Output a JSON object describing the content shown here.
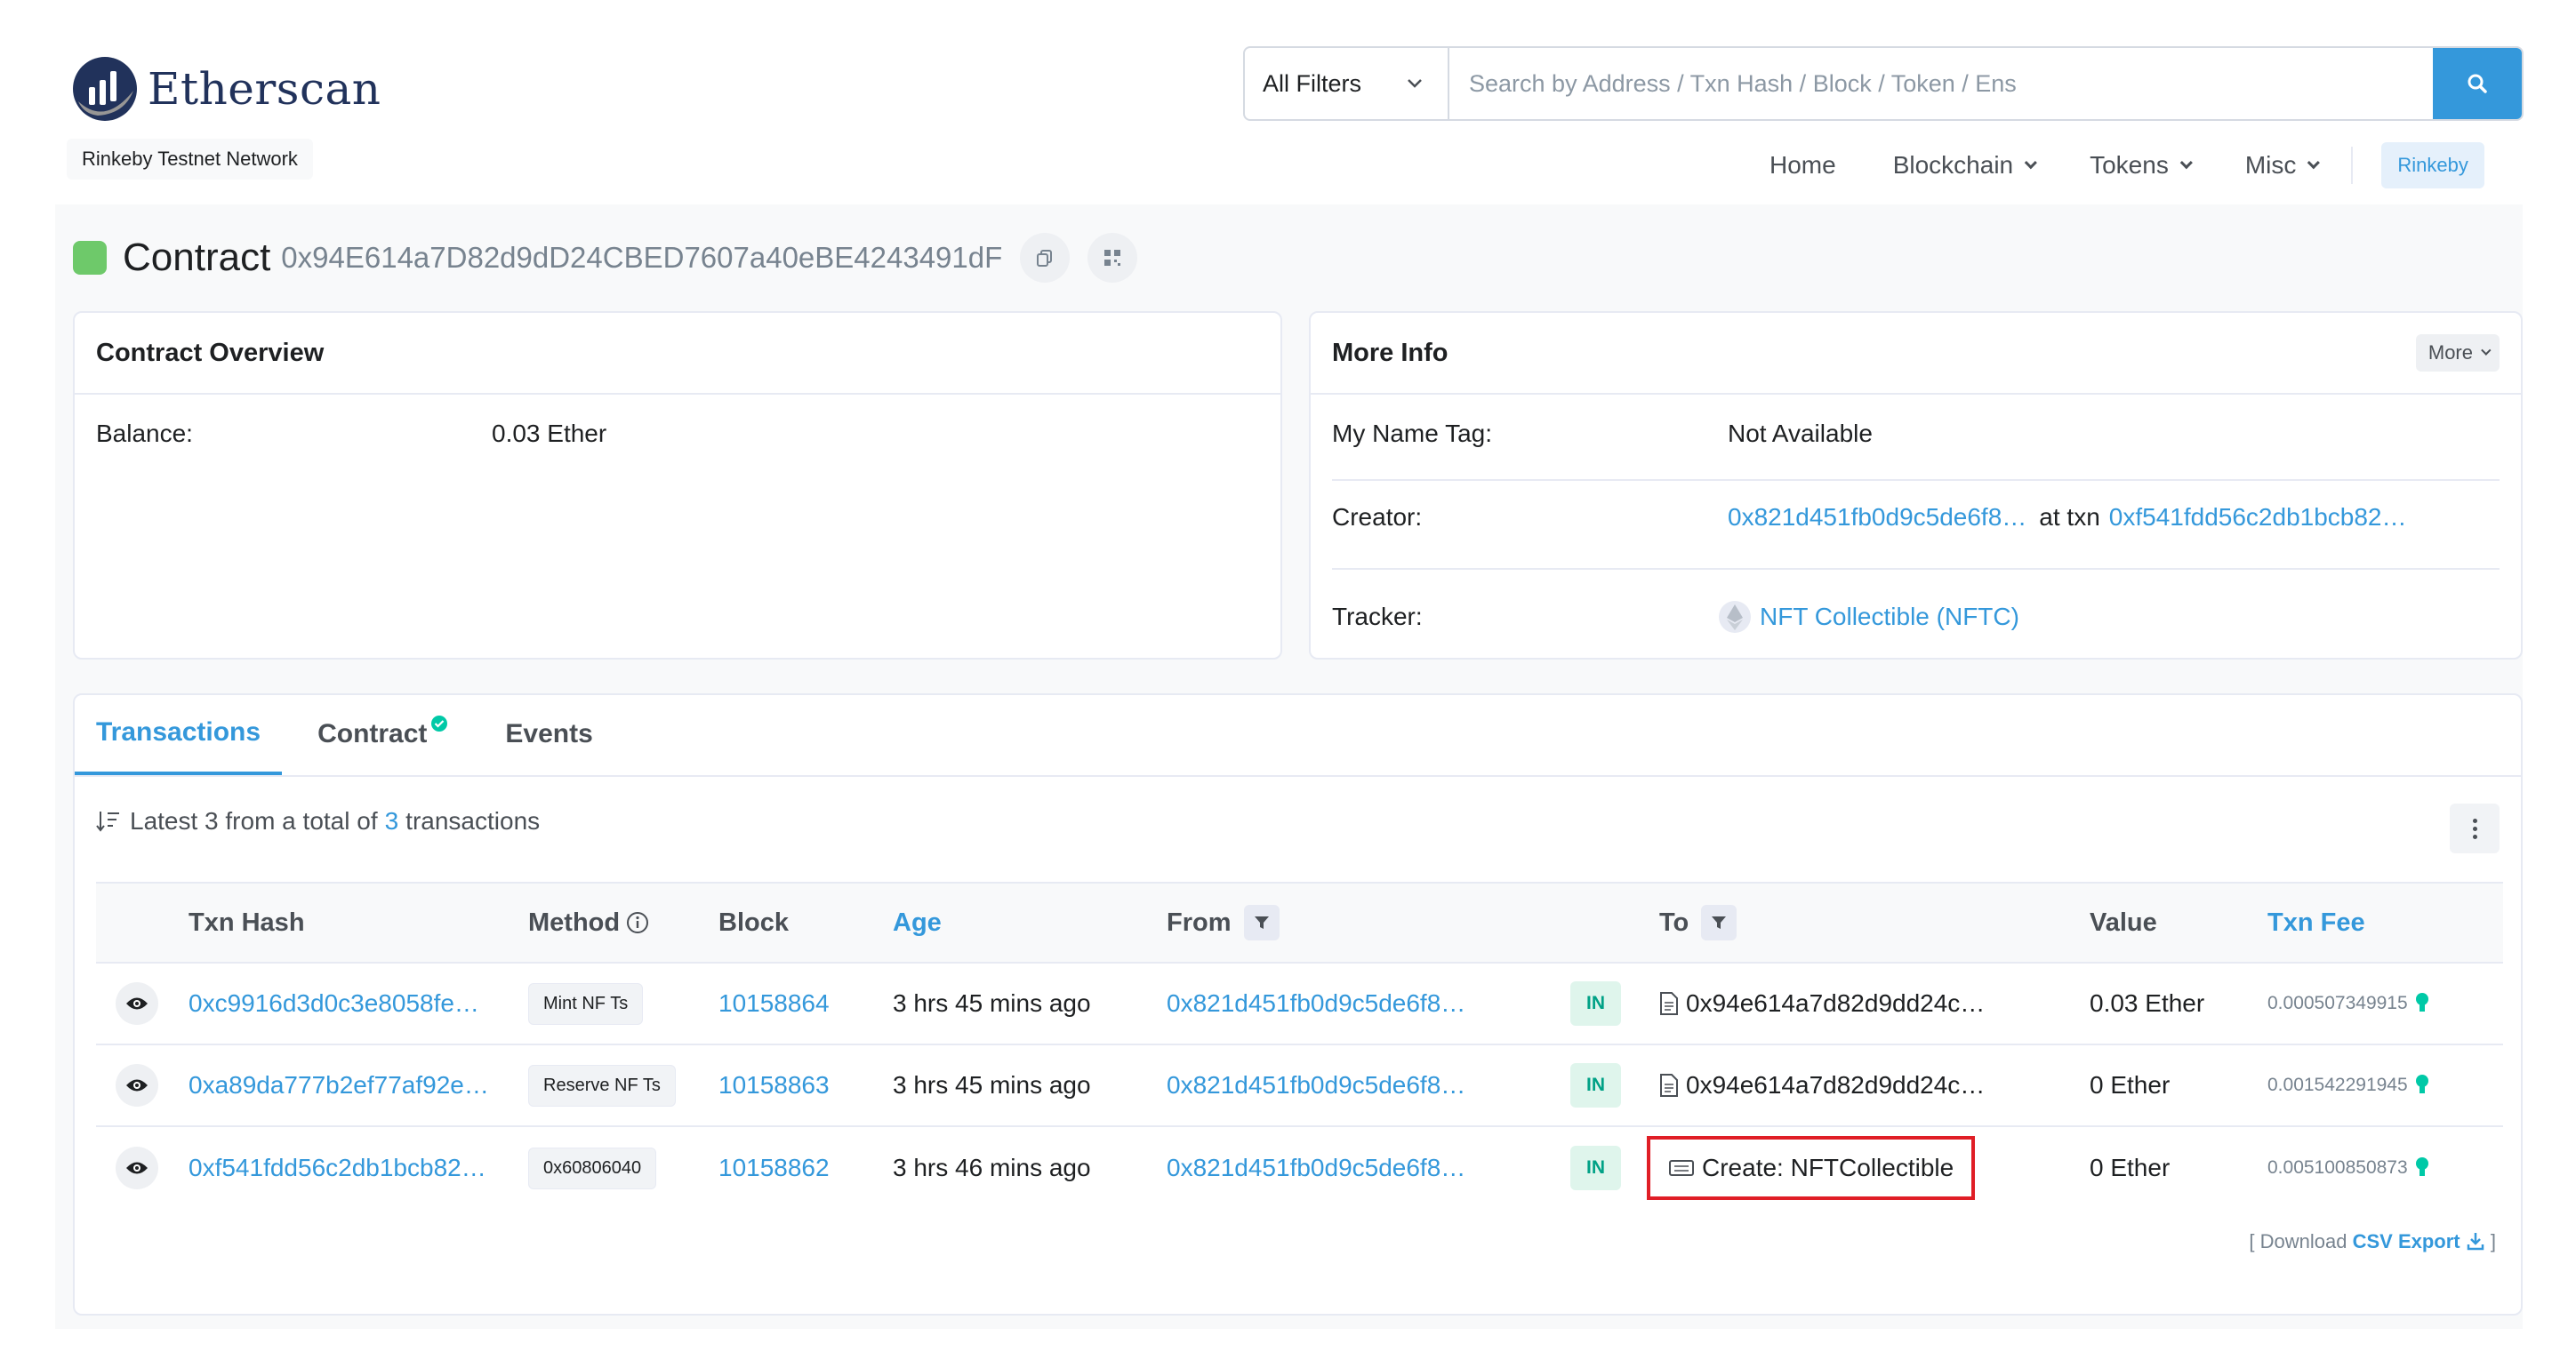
{
  "header": {
    "logo_text": "Etherscan",
    "network_badge": "Rinkeby Testnet Network",
    "search": {
      "filter_label": "All Filters",
      "placeholder": "Search by Address / Txn Hash / Block / Token / Ens"
    },
    "nav": {
      "home": "Home",
      "blockchain": "Blockchain",
      "tokens": "Tokens",
      "misc": "Misc",
      "network_button": "Rinkeby"
    }
  },
  "contract": {
    "title": "Contract",
    "address": "0x94E614a7D82d9dD24CBED7607a40eBE4243491dF"
  },
  "overview": {
    "heading": "Contract Overview",
    "balance_label": "Balance:",
    "balance_value": "0.03 Ether"
  },
  "more_info": {
    "heading": "More Info",
    "more_button": "More",
    "name_tag_label": "My Name Tag:",
    "name_tag_value": "Not Available",
    "creator_label": "Creator:",
    "creator_address": "0x821d451fb0d9c5de6f8…",
    "creator_at_txn": "at txn",
    "creator_txn": "0xf541fdd56c2db1bcb82…",
    "tracker_label": "Tracker:",
    "tracker_value": "NFT Collectible (NFTC)"
  },
  "tabs": {
    "transactions": "Transactions",
    "contract": "Contract",
    "events": "Events"
  },
  "summary": {
    "prefix": "Latest 3 from a total of",
    "count": "3",
    "suffix": "transactions"
  },
  "table": {
    "headers": {
      "txn_hash": "Txn Hash",
      "method": "Method",
      "block": "Block",
      "age": "Age",
      "from": "From",
      "to": "To",
      "value": "Value",
      "txn_fee": "Txn Fee"
    },
    "rows": [
      {
        "hash": "0xc9916d3d0c3e8058fe…",
        "method": "Mint NF Ts",
        "block": "10158864",
        "age": "3 hrs 45 mins ago",
        "from": "0x821d451fb0d9c5de6f8…",
        "direction": "IN",
        "to": "0x94e614a7d82d9dd24c…",
        "value": "0.03 Ether",
        "fee": "0.000507349915"
      },
      {
        "hash": "0xa89da777b2ef77af92e…",
        "method": "Reserve NF Ts",
        "block": "10158863",
        "age": "3 hrs 45 mins ago",
        "from": "0x821d451fb0d9c5de6f8…",
        "direction": "IN",
        "to": "0x94e614a7d82d9dd24c…",
        "value": "0 Ether",
        "fee": "0.001542291945"
      },
      {
        "hash": "0xf541fdd56c2db1bcb82…",
        "method": "0x60806040",
        "block": "10158862",
        "age": "3 hrs 46 mins ago",
        "from": "0x821d451fb0d9c5de6f8…",
        "direction": "IN",
        "to": "Create: NFTCollectible",
        "value": "0 Ether",
        "fee": "0.005100850873"
      }
    ]
  },
  "csv": {
    "prefix": "[ Download",
    "label": "CSV Export",
    "suffix": "]"
  },
  "colors": {
    "accent": "#3498db",
    "highlight": "#e01e26",
    "in_badge_bg": "#dff5ec",
    "in_badge_text": "#00a186"
  }
}
